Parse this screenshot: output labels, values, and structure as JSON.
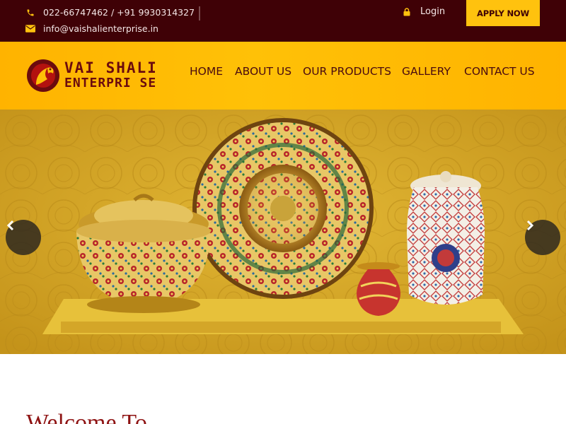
{
  "topbar": {
    "phone": "022-66747462 / +91 9930314327",
    "email": "info@vaishalienterprise.in",
    "login_label": "Login",
    "apply_label": "APPLY NOW",
    "icons": {
      "phone": "phone-icon",
      "email": "envelope-icon",
      "login": "lock-icon"
    },
    "colors": {
      "background": "#3f0106",
      "icon": "#ffc20e",
      "button": "#ffc20e"
    }
  },
  "header": {
    "logo": {
      "line1": "VAI SHALI",
      "line2": "ENTERPRI SE"
    },
    "nav": [
      "HOME",
      "ABOUT US",
      "OUR PRODUCTS",
      "GALLERY",
      "CONTACT US"
    ],
    "colors": {
      "background": "#ffc107",
      "nav_text": "#4a0a10"
    }
  },
  "hero": {
    "prev_icon": "chevron-left-icon",
    "next_icon": "chevron-right-icon"
  },
  "welcome": {
    "heading": "Welcome To"
  }
}
